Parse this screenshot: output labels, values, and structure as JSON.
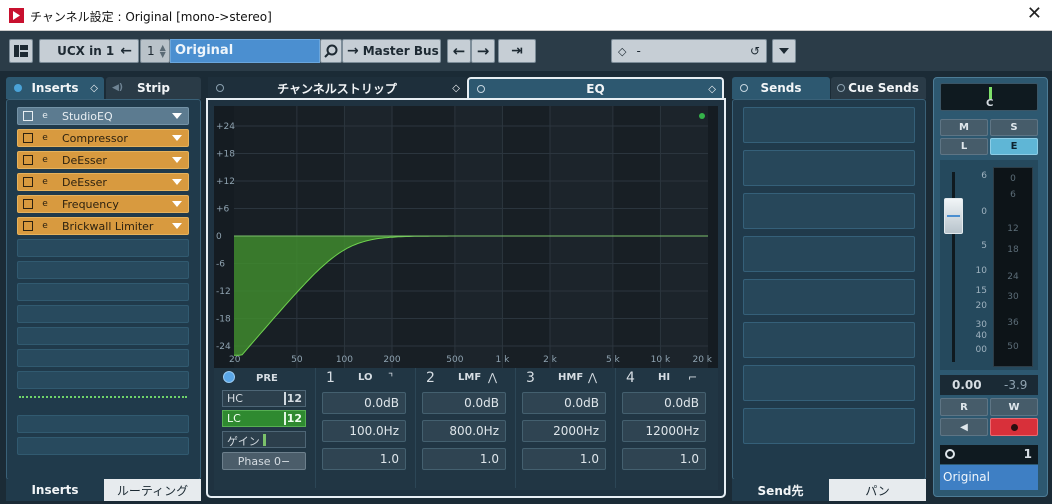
{
  "window": {
    "title": "チャンネル設定 : Original [mono->stereo]",
    "close": "✕"
  },
  "toolbar": {
    "input_routing": "UCX in 1",
    "channel_number": "1",
    "channel_name": "Original",
    "output_routing": "Master Bus",
    "preset": "-"
  },
  "left_tabs": {
    "inserts": "Inserts",
    "strip": "Strip"
  },
  "inserts": [
    {
      "name": "StudioEQ"
    },
    {
      "name": "Compressor"
    },
    {
      "name": "DeEsser"
    },
    {
      "name": "DeEsser"
    },
    {
      "name": "Frequency"
    },
    {
      "name": "Brickwall Limiter"
    }
  ],
  "left_bottom_tabs": {
    "inserts": "Inserts",
    "routing": "ルーティング"
  },
  "center_tabs": {
    "strip": "チャンネルストリップ",
    "eq": "EQ"
  },
  "eq": {
    "y_ticks": [
      "+24",
      "+18",
      "+12",
      "+6",
      "0",
      "-6",
      "-12",
      "-18",
      "-24"
    ],
    "x_ticks": [
      "20",
      "50",
      "100",
      "200",
      "500",
      "1 k",
      "2 k",
      "5 k",
      "10 k",
      "20 k"
    ],
    "pre_label": "PRE",
    "hc_label": "HC",
    "hc_slope": "12",
    "lc_label": "LC",
    "lc_slope": "12",
    "gain_label": "ゲイン",
    "phase_label": "Phase 0−",
    "bands": [
      {
        "num": "1",
        "type": "LO",
        "gain": "0.0dB",
        "freq": "100.0Hz",
        "q": "1.0"
      },
      {
        "num": "2",
        "type": "LMF",
        "gain": "0.0dB",
        "freq": "800.0Hz",
        "q": "1.0"
      },
      {
        "num": "3",
        "type": "HMF",
        "gain": "0.0dB",
        "freq": "2000Hz",
        "q": "1.0"
      },
      {
        "num": "4",
        "type": "HI",
        "gain": "0.0dB",
        "freq": "12000Hz",
        "q": "1.0"
      }
    ],
    "lowcut_curve_color": "#3f8a2e"
  },
  "sends_tabs": {
    "sends": "Sends",
    "cue_sends": "Cue Sends"
  },
  "sends_bottom_tabs": {
    "dest": "Send先",
    "pan": "パン"
  },
  "fader": {
    "pan": "C",
    "m": "M",
    "s": "S",
    "l": "L",
    "e": "E",
    "scale": [
      "6",
      "0",
      "5",
      "10",
      "15",
      "20",
      "30",
      "40",
      "00"
    ],
    "meter_scale": [
      "0",
      "6",
      "12",
      "18",
      "24",
      "30",
      "36",
      "50"
    ],
    "volume": "0.00",
    "peak": "-3.9",
    "r": "R",
    "w": "W",
    "channel_index": "1",
    "channel_name": "Original"
  }
}
